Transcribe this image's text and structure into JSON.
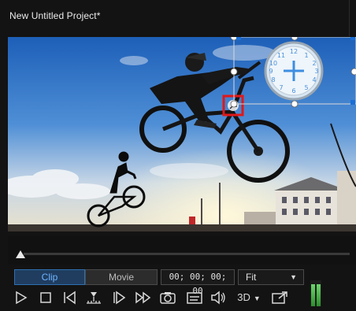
{
  "app": {
    "title": "New Untitled Project*"
  },
  "view_mode": {
    "clip_label": "Clip",
    "movie_label": "Movie",
    "active": "Clip"
  },
  "timecode": "00; 00; 00; 00",
  "zoom": {
    "selected": "Fit"
  },
  "toolbar": {
    "mode_3d_label": "3D",
    "buttons": [
      "play-icon",
      "stop-icon",
      "previous-frame-icon",
      "split-icon",
      "next-frame-icon",
      "fast-forward-icon",
      "snapshot-icon",
      "subtitle-icon",
      "volume-icon",
      "3d-mode-icon",
      "external-display-icon"
    ]
  },
  "scrubber": {
    "position": 0
  },
  "audio_meter": {
    "left_level": 0.85,
    "right_level": 0.85
  },
  "colors": {
    "accent": "#6db4ff",
    "selection_handle": "#1a6fd6",
    "keyframe_marker": "#e01818"
  }
}
